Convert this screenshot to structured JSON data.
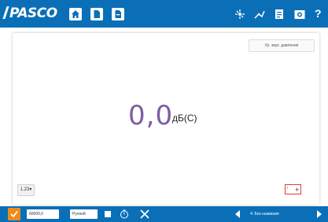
{
  "topbar": {
    "logo": "PASCO",
    "left_icons": [
      "home-icon",
      "document-icon",
      "document-export-icon"
    ],
    "right_icons": [
      "sensor-icon",
      "hardware-setup-icon",
      "data-summary-icon",
      "camera-icon"
    ],
    "help_label": "?"
  },
  "main": {
    "sensor_label": "Ур. звук. давления",
    "value": "0,0",
    "unit": "дБ(C)",
    "digits_button": "1.23",
    "marker_text": "Ӏ"
  },
  "bottombar": {
    "rate_field": "60000,0",
    "mode_field": "Ручной",
    "page_label": "4: Без названия"
  },
  "colors": {
    "bar_blue": "#0a6fb7",
    "accent_orange": "#f08a1c",
    "value_purple": "#7f5ca3",
    "marker_red": "#e53935"
  }
}
